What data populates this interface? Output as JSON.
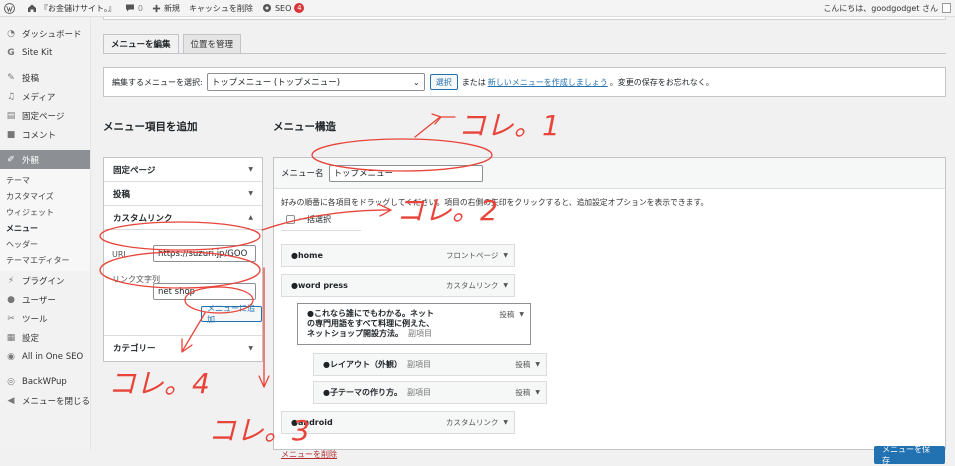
{
  "adminbar": {
    "site_name": "『お金儲けサイト。』",
    "comments_count": "0",
    "new_label": "新規",
    "cache_label": "キャッシュを削除",
    "seo_label": "SEO",
    "seo_badge": "4",
    "greeting": "こんにちは、goodgodget さん"
  },
  "sidebar": {
    "items": [
      {
        "label": "ダッシュボード",
        "icon": "dashboard-icon"
      },
      {
        "label": "Site Kit",
        "icon": "google-g-icon"
      },
      {
        "label": "投稿",
        "icon": "pin-icon"
      },
      {
        "label": "メディア",
        "icon": "media-icon"
      },
      {
        "label": "固定ページ",
        "icon": "page-icon"
      },
      {
        "label": "コメント",
        "icon": "comment-icon"
      },
      {
        "label": "外観",
        "icon": "brush-icon"
      },
      {
        "label": "プラグイン",
        "icon": "plugin-icon"
      },
      {
        "label": "ユーザー",
        "icon": "user-icon"
      },
      {
        "label": "ツール",
        "icon": "wrench-icon"
      },
      {
        "label": "設定",
        "icon": "settings-icon"
      },
      {
        "label": "All in One SEO",
        "icon": "seo-icon"
      },
      {
        "label": "BackWPup",
        "icon": "backup-icon"
      },
      {
        "label": "メニューを閉じる",
        "icon": "collapse-icon"
      }
    ],
    "submenu": [
      "テーマ",
      "カスタマイズ",
      "ウィジェット",
      "メニュー",
      "ヘッダー",
      "テーマエディター"
    ]
  },
  "tabs": [
    "メニューを編集",
    "位置を管理"
  ],
  "select_row": {
    "label": "編集するメニューを選択:",
    "selected": "トップメニュー (トップメニュー)",
    "select_button": "選択",
    "or_text": "または",
    "create_link": "新しいメニューを作成しましょう",
    "after_text": "。変更の保存をお忘れなく。"
  },
  "add_items": {
    "heading": "メニュー項目を追加",
    "sections": [
      "固定ページ",
      "投稿",
      "カスタムリンク",
      "カテゴリー"
    ],
    "url_label": "URL",
    "url_value": "https://suzuri.jp/GOO",
    "link_text_label": "リンク文字列",
    "link_text_value": "net shop",
    "add_button": "メニューに追加"
  },
  "structure": {
    "heading": "メニュー構造",
    "name_label": "メニュー名",
    "name_value": "トップメニュー",
    "instructions": "好みの順番に各項目をドラッグしてください。項目の右側の矢印をクリックすると、追加設定オプションを表示できます。",
    "bulk_select": "一括選択",
    "items": [
      {
        "title": "●home",
        "type": "フロントページ"
      },
      {
        "title": "●word press",
        "type": "カスタムリンク"
      },
      {
        "title_lines": [
          "●これなら誰にでもわかる。ネット",
          "の専門用語をすべて料理に例えた、",
          "ネットショップ開設方法。"
        ],
        "sub": "副項目",
        "type": "投稿"
      },
      {
        "title": "●レイアウト（外観）",
        "sub": "副項目",
        "type": "投稿"
      },
      {
        "title": "●子テーマの作り方。",
        "sub": "副項目",
        "type": "投稿"
      },
      {
        "title": "●android",
        "type": "カスタムリンク"
      }
    ],
    "delete_link": "メニューを削除",
    "save_button": "メニューを保存"
  },
  "annotations": [
    "コレ。1",
    "コレ。2",
    "コレ。3",
    "コレ。4"
  ],
  "colors": {
    "annotation": "#e8443a",
    "primary": "#2271b1",
    "active_menu": "#8c8f94"
  }
}
